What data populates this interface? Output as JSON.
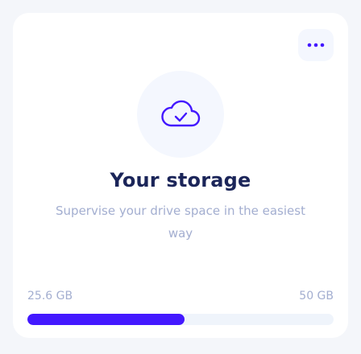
{
  "menu": {
    "icon": "more-horizontal-icon",
    "color": "#4318ff"
  },
  "header_icon": "cloud-check-icon",
  "title": "Your storage",
  "subtitle": "Supervise your drive space in the easiest way",
  "storage": {
    "used_label": "25.6 GB",
    "total_label": "50 GB",
    "used_fraction": 0.512
  },
  "colors": {
    "accent": "#4318ff",
    "title": "#1b2559",
    "muted": "#a3aed0",
    "track": "#eff4fb"
  }
}
